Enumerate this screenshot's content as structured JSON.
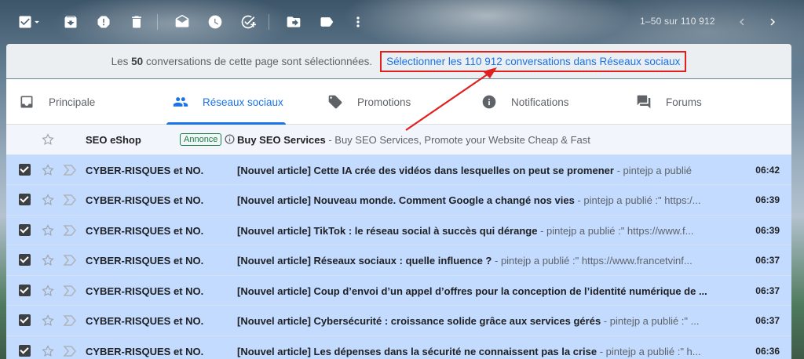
{
  "toolbar": {
    "page_count": "1–50 sur 110 912",
    "icons": [
      "select-checkbox-icon",
      "chevron-down-icon",
      "archive-icon",
      "report-spam-icon",
      "delete-icon",
      "mark-read-icon",
      "snooze-icon",
      "add-task-icon",
      "move-to-icon",
      "label-icon",
      "more-vert-icon",
      "chevron-left-icon",
      "chevron-right-icon"
    ]
  },
  "banner": {
    "msg_prefix": "Les ",
    "msg_count": "50",
    "msg_suffix": " conversations de cette page sont sélectionnées.",
    "select_all": "Sélectionner les 110 912 conversations dans Réseaux sociaux"
  },
  "tabs": [
    {
      "label": "Principale",
      "icon": "inbox-icon"
    },
    {
      "label": "Réseaux sociaux",
      "icon": "people-icon",
      "active": true
    },
    {
      "label": "Promotions",
      "icon": "tag-icon"
    },
    {
      "label": "Notifications",
      "icon": "info-icon"
    },
    {
      "label": "Forums",
      "icon": "forum-icon"
    }
  ],
  "ad_row": {
    "sender": "SEO eShop",
    "badge": "Annonce",
    "subject": "Buy SEO Services",
    "snippet": " - Buy SEO Services, Promote your Website Cheap & Fast"
  },
  "rows": [
    {
      "sender": "CYBER-RISQUES et NO.",
      "subject": "[Nouvel article] Cette IA crée des vidéos dans lesquelles on peut se promener",
      "snippet": " - pintejp a publié",
      "time": "06:42"
    },
    {
      "sender": "CYBER-RISQUES et NO.",
      "subject": "[Nouvel article] Nouveau monde. Comment Google a changé nos vies",
      "snippet": " - pintejp a publié :\" https:/...",
      "time": "06:39"
    },
    {
      "sender": "CYBER-RISQUES et NO.",
      "subject": "[Nouvel article] TikTok : le réseau social à succès qui dérange",
      "snippet": " - pintejp a publié :\" https://www.f...",
      "time": "06:39"
    },
    {
      "sender": "CYBER-RISQUES et NO.",
      "subject": "[Nouvel article] Réseaux sociaux : quelle influence ?",
      "snippet": " - pintejp a publié :\" https://www.francetvinf...",
      "time": "06:37"
    },
    {
      "sender": "CYBER-RISQUES et NO.",
      "subject": "[Nouvel article] Coup d’envoi d’un appel d’offres pour la conception de l’identité numérique de ...",
      "snippet": "",
      "time": "06:37"
    },
    {
      "sender": "CYBER-RISQUES et NO.",
      "subject": "[Nouvel article] Cybersécurité : croissance solide grâce aux services gérés",
      "snippet": " - pintejp a publié :\" ...",
      "time": "06:37"
    },
    {
      "sender": "CYBER-RISQUES et NO.",
      "subject": "[Nouvel article] Les dépenses dans la sécurité ne connaissent pas la crise",
      "snippet": " - pintejp a publié :\" h...",
      "time": "06:36"
    }
  ],
  "colors": {
    "accent": "#1a73e8",
    "selected_row": "#c2dbff",
    "annotation_red": "#e0201f"
  }
}
